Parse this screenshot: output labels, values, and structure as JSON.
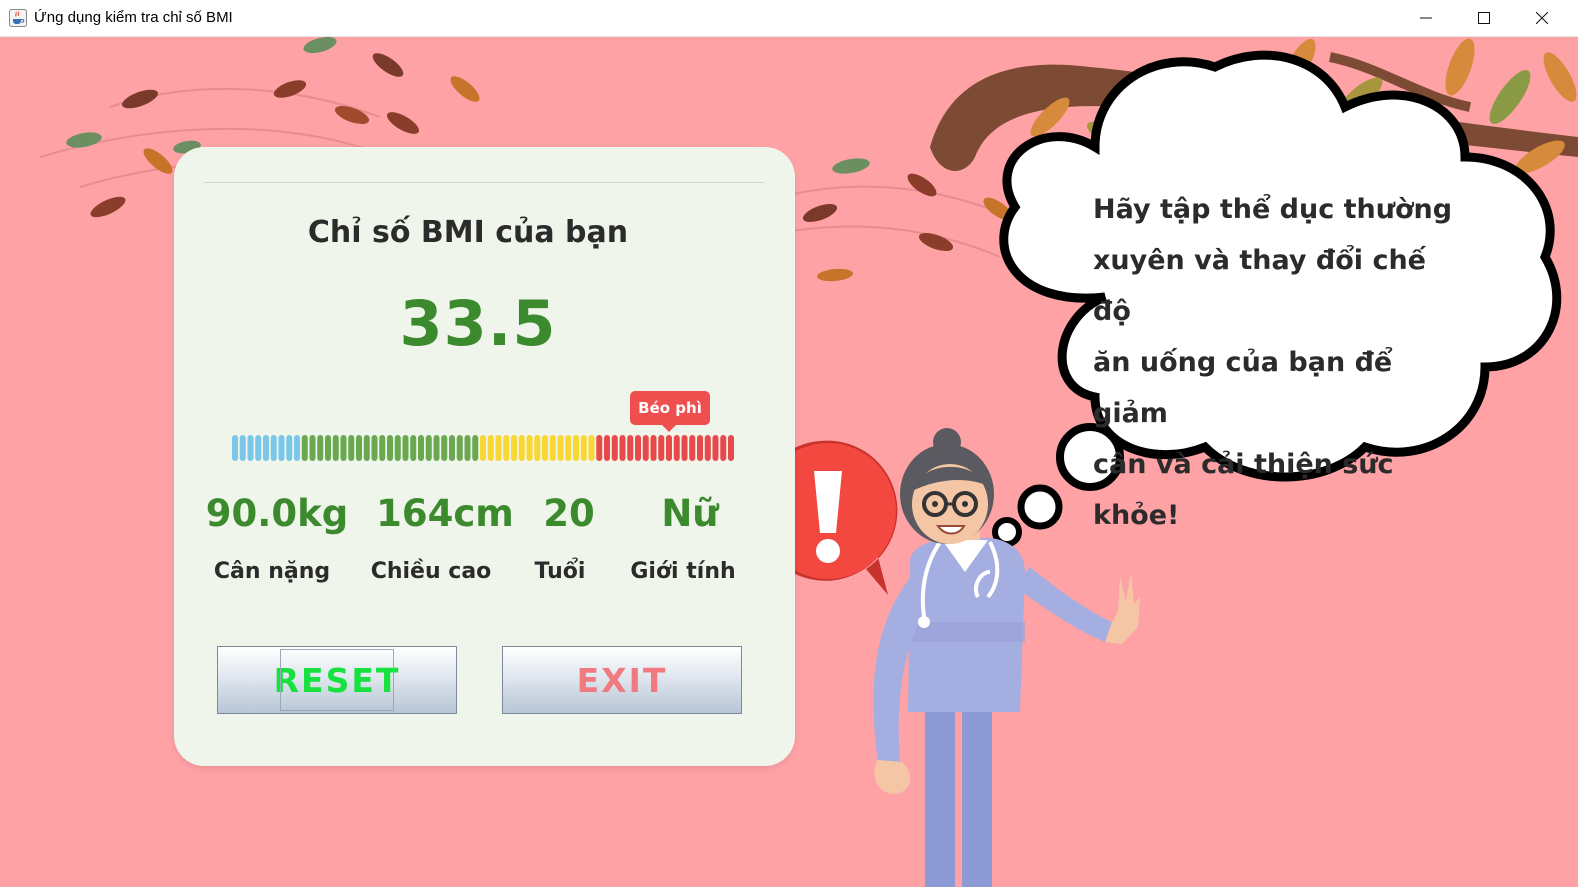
{
  "window": {
    "title": "Ứng dụng kiểm tra chỉ số BMI",
    "app_icon": "java-cup-icon",
    "controls": [
      "minimize-icon",
      "maximize-icon",
      "close-icon"
    ]
  },
  "result": {
    "heading": "Chỉ số BMI của bạn",
    "bmi": "33.5",
    "category_badge": "Béo phì",
    "meter_level_percent": 88
  },
  "stats": [
    {
      "value": "90.0kg",
      "label": "Cân nặng"
    },
    {
      "value": "164cm",
      "label": "Chiều cao"
    },
    {
      "value": "20",
      "label": "Tuổi"
    },
    {
      "value": "Nữ",
      "label": "Giới tính"
    }
  ],
  "buttons": {
    "reset": "RESET",
    "exit": "EXIT"
  },
  "advice": {
    "lines": [
      "Hãy tập thể dục thường",
      "xuyên và thay đổi chế độ",
      "ăn uống của bạn để giảm",
      "cân và cải thiện sức khỏe!"
    ]
  },
  "colors": {
    "background": "#fea2a6",
    "card": "#eff5ea",
    "value_green": "#3c8a2e",
    "badge_red": "#ef4f4f",
    "meter_blue": "#7cc6ea",
    "meter_green": "#6aa84f",
    "meter_yellow": "#f8d633",
    "meter_red": "#e8494a",
    "reset_text": "#16e13f",
    "exit_text": "#f07a80"
  }
}
